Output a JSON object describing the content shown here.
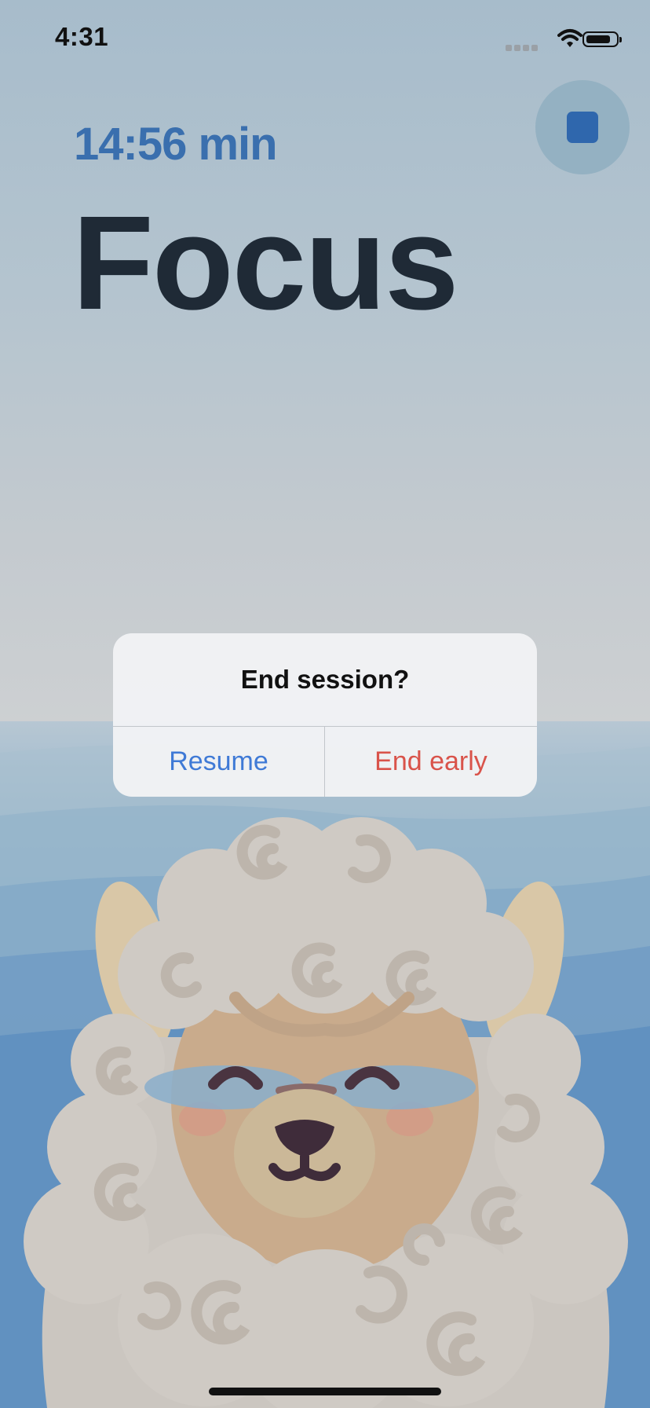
{
  "status_bar": {
    "time": "4:31"
  },
  "session": {
    "timer": "14:56 min",
    "title": "Focus"
  },
  "dialog": {
    "title": "End session?",
    "resume_label": "Resume",
    "end_label": "End early"
  },
  "colors": {
    "accent": "#3a6fae",
    "resume": "#3f7ad6",
    "end_early": "#d9534a",
    "title_text": "#1f2a36"
  },
  "icons": {
    "stop": "stop-icon",
    "wifi": "wifi-icon",
    "battery": "battery-icon",
    "signal": "signal-icon"
  }
}
